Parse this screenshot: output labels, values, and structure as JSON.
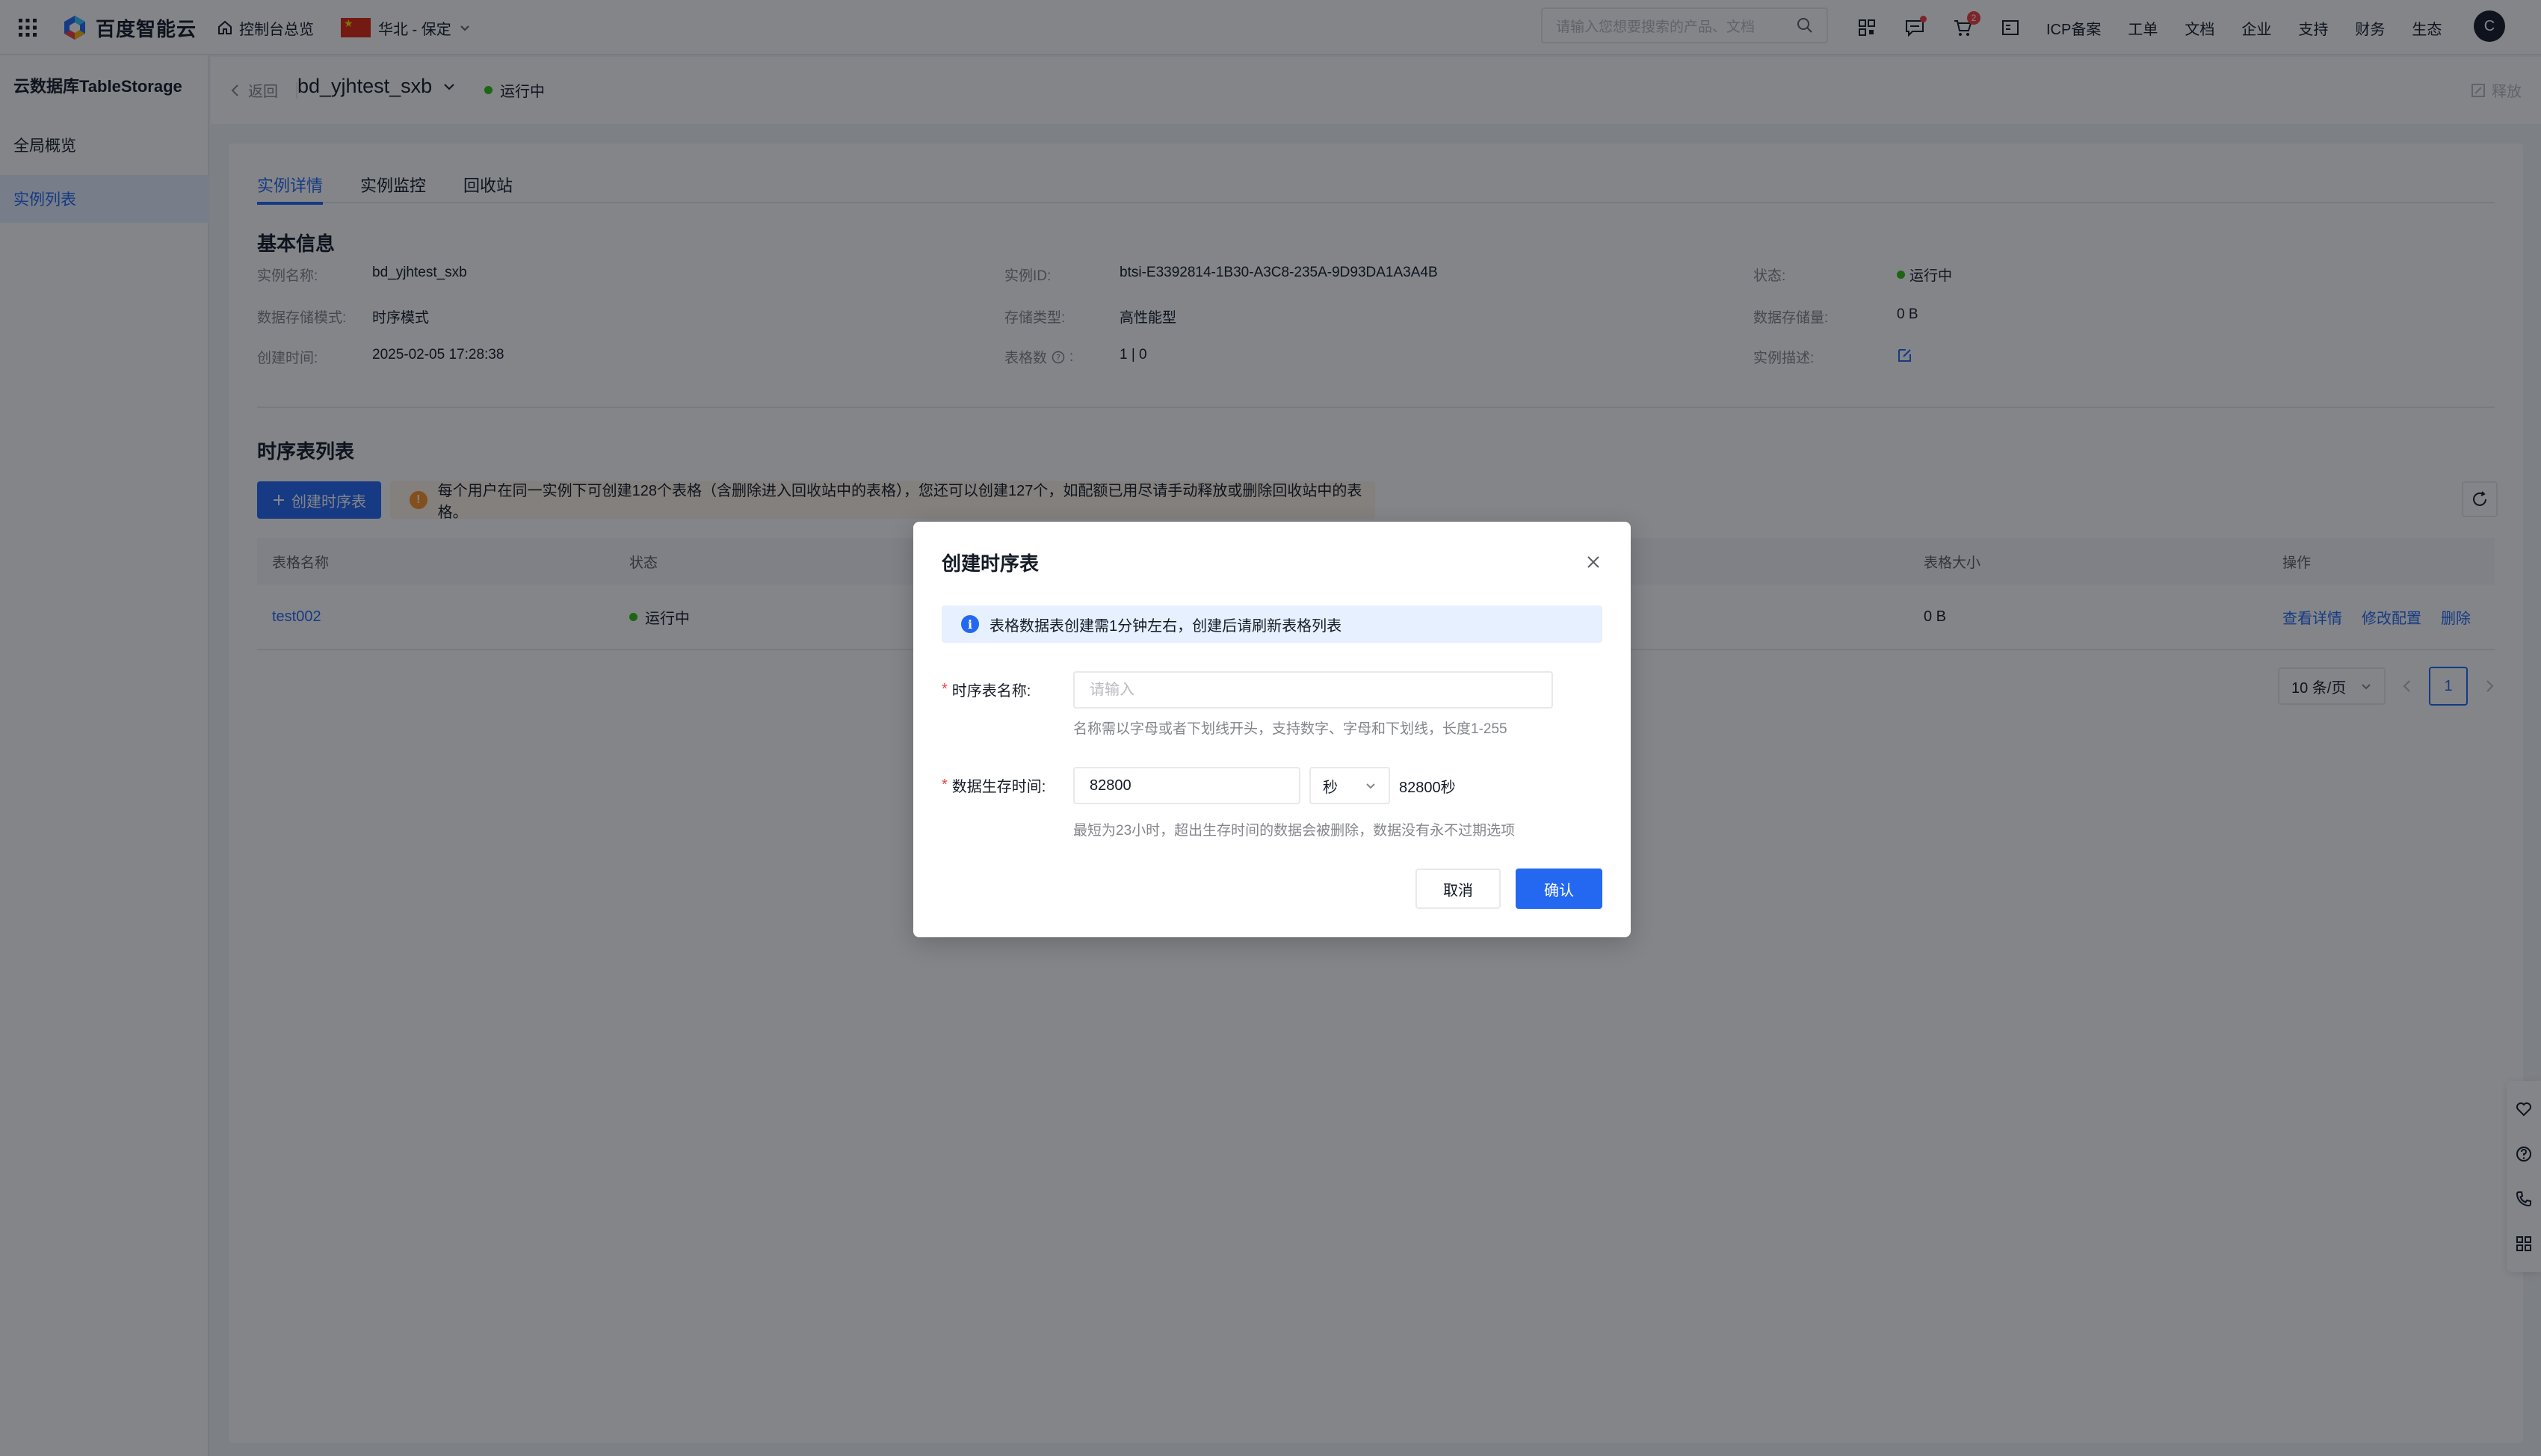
{
  "header": {
    "logo_text": "百度智能云",
    "console_label": "控制台总览",
    "region_label": "华北 - 保定",
    "search_placeholder": "请输入您想要搜索的产品、文档",
    "cart_badge": "2",
    "links": [
      "ICP备案",
      "工单",
      "文档",
      "企业",
      "支持",
      "财务",
      "生态"
    ],
    "avatar_letter": "C"
  },
  "sidebar": {
    "title": "云数据库TableStorage",
    "items": [
      {
        "label": "全局概览",
        "active": false
      },
      {
        "label": "实例列表",
        "active": true
      }
    ]
  },
  "subheader": {
    "back_label": "返回",
    "instance_name": "bd_yjhtest_sxb",
    "status": "运行中",
    "release_label": "释放"
  },
  "tabs": [
    "实例详情",
    "实例监控",
    "回收站"
  ],
  "basic_info": {
    "title": "基本信息",
    "rows": [
      [
        {
          "label": "实例名称:",
          "value": "bd_yjhtest_sxb"
        },
        {
          "label": "实例ID:",
          "value": "btsi-E3392814-1B30-A3C8-235A-9D93DA1A3A4B"
        },
        {
          "label": "状态:",
          "value": "运行中"
        }
      ],
      [
        {
          "label": "数据存储模式:",
          "value": "时序模式"
        },
        {
          "label": "存储类型:",
          "value": "高性能型"
        },
        {
          "label": "数据存储量:",
          "value": "0 B"
        }
      ],
      [
        {
          "label": "创建时间:",
          "value": "2025-02-05 17:28:38"
        },
        {
          "label": "表格数",
          "value": "1 | 0"
        },
        {
          "label": "实例描述:",
          "value": ""
        }
      ]
    ]
  },
  "table_section": {
    "title": "时序表列表",
    "create_label": "创建时序表",
    "warning": "每个用户在同一实例下可创建128个表格（含删除进入回收站中的表格），您还可以创建127个，如配额已用尽请手动释放或删除回收站中的表格。",
    "columns": [
      "表格名称",
      "状态",
      "表格大小",
      "操作"
    ],
    "rows": [
      {
        "name": "test002",
        "status": "运行中",
        "size": "0 B",
        "actions": [
          "查看详情",
          "修改配置",
          "删除"
        ]
      }
    ],
    "page_size": "10 条/页",
    "page": "1"
  },
  "modal": {
    "title": "创建时序表",
    "info": "表格数据表创建需1分钟左右，创建后请刷新表格列表",
    "name_label": "时序表名称:",
    "name_placeholder": "请输入",
    "name_hint": "名称需以字母或者下划线开头，支持数字、字母和下划线，长度1-255",
    "ttl_label": "数据生存时间:",
    "ttl_value": "82800",
    "ttl_unit": "秒",
    "ttl_calc": "82800秒",
    "ttl_hint": "最短为23小时，超出生存时间的数据会被删除，数据没有永不过期选项",
    "cancel_label": "取消",
    "confirm_label": "确认"
  }
}
